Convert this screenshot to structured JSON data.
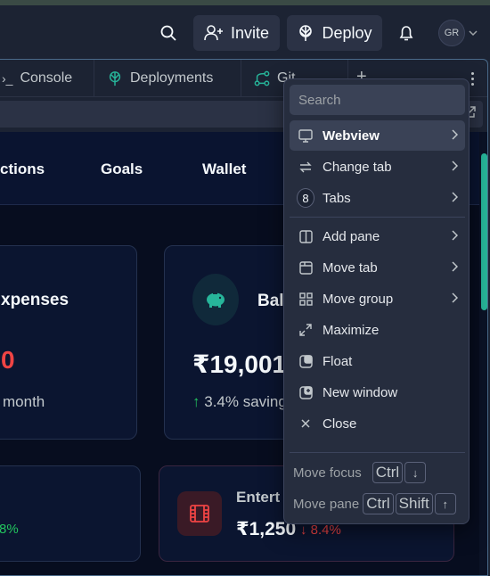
{
  "topbar": {
    "invite_label": "Invite",
    "deploy_label": "Deploy",
    "avatar_initials": "GR"
  },
  "tabs": [
    {
      "label": "Console"
    },
    {
      "label": "Deployments"
    },
    {
      "label": "Git"
    }
  ],
  "webview": {
    "nav": [
      "ctions",
      "Goals",
      "Wallet"
    ],
    "expenses": {
      "title": "xpenses",
      "value": "0",
      "note": "month"
    },
    "balance": {
      "title": "Bal",
      "value": "₹19,001",
      "trend": "3.4% saving"
    },
    "card3": {
      "trend": "8%"
    },
    "entertainment": {
      "title": "Entert",
      "value": "₹1,250",
      "trend": "8.4%"
    },
    "colors": {
      "accent": "#27b59a",
      "negative": "#ef4444",
      "positive": "#22c55e"
    }
  },
  "menu": {
    "search_placeholder": "Search",
    "items": [
      {
        "label": "Webview",
        "icon": "monitor-icon",
        "submenu": true,
        "active": true
      },
      {
        "label": "Change tab",
        "icon": "swap-icon",
        "submenu": true
      },
      {
        "label": "Tabs",
        "icon": "tab-count-badge",
        "badge": "8",
        "submenu": true
      },
      {
        "label": "Add pane",
        "icon": "split-pane-icon",
        "submenu": true
      },
      {
        "label": "Move tab",
        "icon": "move-tab-icon",
        "submenu": true
      },
      {
        "label": "Move group",
        "icon": "grid-icon",
        "submenu": true
      },
      {
        "label": "Maximize",
        "icon": "maximize-icon"
      },
      {
        "label": "Float",
        "icon": "float-icon"
      },
      {
        "label": "New window",
        "icon": "new-window-icon"
      },
      {
        "label": "Close",
        "icon": "close-icon"
      }
    ],
    "shortcuts": [
      {
        "label": "Move focus",
        "keys": [
          "Ctrl",
          "↓"
        ]
      },
      {
        "label": "Move pane",
        "keys": [
          "Ctrl",
          "Shift",
          "↑"
        ]
      }
    ]
  }
}
